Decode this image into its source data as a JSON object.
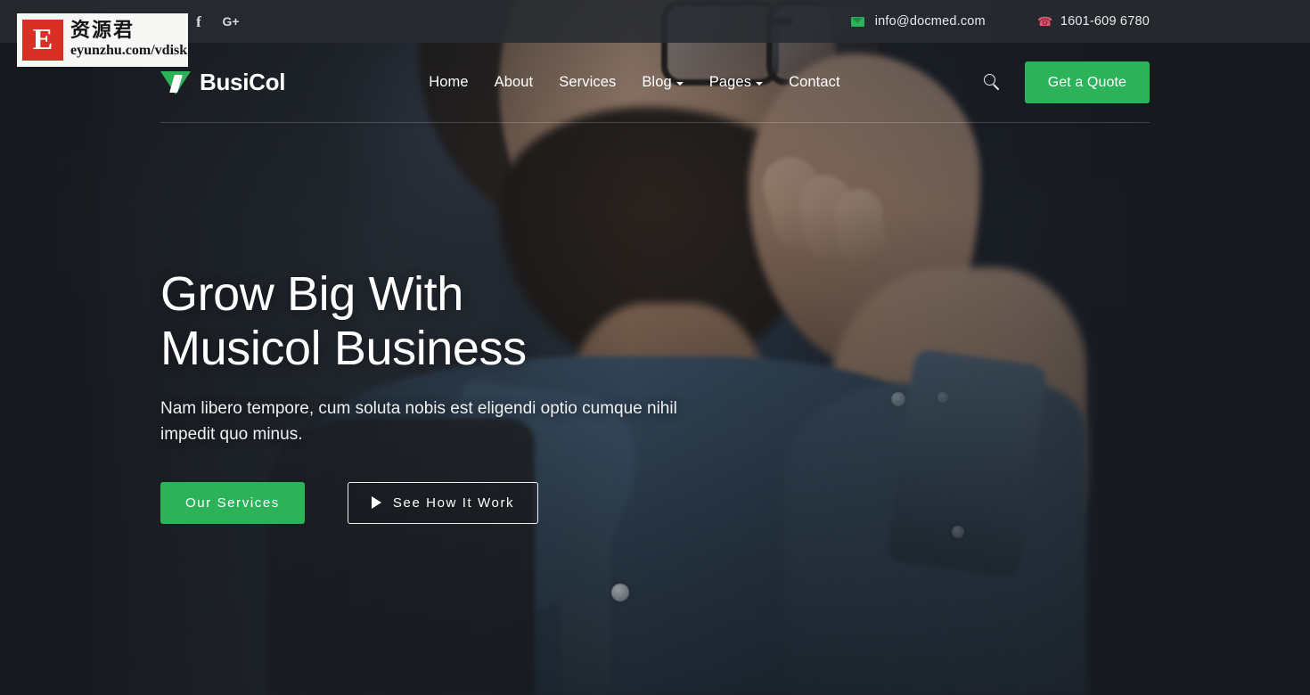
{
  "topbar": {
    "social": [
      {
        "name": "twitter",
        "glyph": "•"
      },
      {
        "name": "facebook",
        "glyph": "f"
      },
      {
        "name": "google-plus",
        "glyph": "G+"
      }
    ],
    "email": "info@docmed.com",
    "phone": "1601-609 6780"
  },
  "header": {
    "brand": "BusiCol",
    "nav": [
      {
        "label": "Home",
        "caret": false
      },
      {
        "label": "About",
        "caret": false
      },
      {
        "label": "Services",
        "caret": false
      },
      {
        "label": "Blog",
        "caret": true
      },
      {
        "label": "Pages",
        "caret": true
      },
      {
        "label": "Contact",
        "caret": false
      }
    ],
    "quote_button": "Get a Quote",
    "search_aria": "Search"
  },
  "hero": {
    "title_line1": "Grow Big With",
    "title_line2": "Musicol Business",
    "subtitle_line1": "Nam libero tempore, cum soluta nobis est eligendi optio",
    "subtitle_line2": "cumque nihil impedit quo minus.",
    "primary_button": "Our Services",
    "secondary_button": "See How It Work"
  },
  "watermark": {
    "letter": "E",
    "chinese": "资源君",
    "url": "eyunzhu.com/vdisk"
  },
  "colors": {
    "accent_green": "#2cb35a",
    "topbar_bg": "#282b31",
    "page_bg": "#1e2127",
    "watermark_red": "#d93025"
  }
}
